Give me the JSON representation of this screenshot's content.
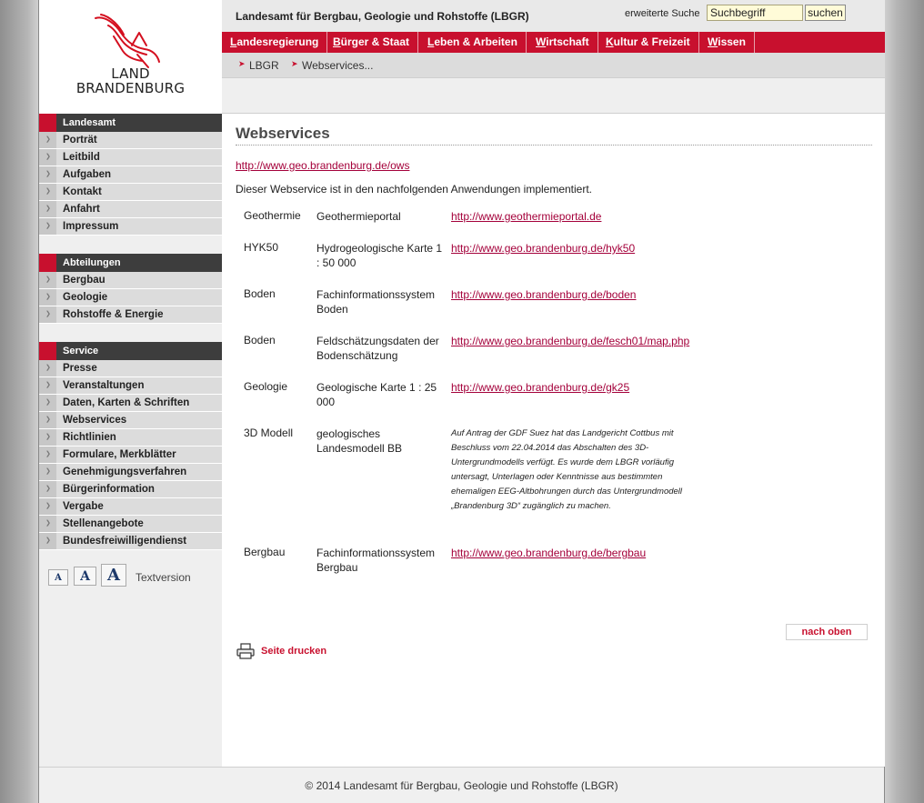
{
  "logo": {
    "line1": "LAND",
    "line2": "BRANDENBURG"
  },
  "header": {
    "site_title": "Landesamt für Bergbau, Geologie und Rohstoffe (LBGR)",
    "extended_search": "erweiterte Suche",
    "search_placeholder": "Suchbegriff",
    "search_button": "suchen"
  },
  "mainnav": [
    {
      "first": "L",
      "rest": "andesregierung"
    },
    {
      "first": "B",
      "rest": "ürger & Staat"
    },
    {
      "first": "L",
      "rest": "eben & Arbeiten"
    },
    {
      "first": "W",
      "rest": "irtschaft"
    },
    {
      "first": "K",
      "rest": "ultur & Freizeit"
    },
    {
      "first": "W",
      "rest": "issen"
    }
  ],
  "breadcrumb": [
    "LBGR",
    "Webservices..."
  ],
  "sidebar": {
    "sections": [
      {
        "title": "Landesamt",
        "items": [
          "Porträt",
          "Leitbild",
          "Aufgaben",
          "Kontakt",
          "Anfahrt",
          "Impressum"
        ]
      },
      {
        "title": "Abteilungen",
        "items": [
          "Bergbau",
          "Geologie",
          "Rohstoffe & Energie"
        ]
      },
      {
        "title": "Service",
        "items": [
          "Presse",
          "Veranstaltungen",
          "Daten, Karten & Schriften",
          "Webservices",
          "Richtlinien",
          "Formulare, Merkblätter",
          "Genehmigungsverfahren",
          "Bürgerinformation",
          "Vergabe",
          "Stellenangebote",
          "Bundesfreiwilligendienst"
        ]
      }
    ],
    "font_sizes": [
      "A",
      "A",
      "A"
    ],
    "textversion": "Textversion"
  },
  "content": {
    "title": "Webservices",
    "ows_link": "http://www.geo.brandenburg.de/ows",
    "intro": "Dieser Webservice ist in den nachfolgenden Anwendungen implementiert.",
    "rows": [
      {
        "topic": "Geothermie",
        "application": "Geothermieportal",
        "link": "http://www.geothermieportal.de"
      },
      {
        "topic": "HYK50",
        "application": "Hydrogeologische Karte 1 : 50 000",
        "link": "http://www.geo.brandenburg.de/hyk50"
      },
      {
        "topic": "Boden",
        "application": "Fachinformationssystem Boden",
        "link": "http://www.geo.brandenburg.de/boden"
      },
      {
        "topic": "Boden",
        "application": "Feldschätzungsdaten der Bodenschätzung",
        "link": "http://www.geo.brandenburg.de/fesch01/map.php"
      },
      {
        "topic": "Geologie",
        "application": "Geologische Karte 1 : 25 000",
        "link": "http://www.geo.brandenburg.de/gk25"
      },
      {
        "topic": "3D Modell",
        "application": "geologisches Landesmodell BB",
        "note": "Auf Antrag der GDF Suez hat das Landgericht Cottbus mit Beschluss vom 22.04.2014 das Abschalten des 3D-Untergrundmodells verfügt. Es wurde dem LBGR vorläufig untersagt, Unterlagen oder Kenntnisse aus bestimmten ehemaligen EEG-Altbohrungen durch das Untergrundmodell „Brandenburg 3D“ zugänglich zu machen."
      },
      {
        "topic": "Bergbau",
        "application": "Fachinformationssystem Bergbau",
        "link": "http://www.geo.brandenburg.de/bergbau"
      }
    ],
    "to_top": "nach oben",
    "print": "Seite drucken"
  },
  "footer": {
    "copyright": "© 2014",
    "org": "Landesamt für Bergbau, Geologie und Rohstoffe (LBGR)"
  },
  "colors": {
    "brand_red": "#c8102e",
    "link": "#a4003a",
    "sidebar_head": "#3d3d3d"
  },
  "icons": [
    "eagle-logo-icon",
    "printer-icon",
    "bullet-arrow-icon"
  ]
}
